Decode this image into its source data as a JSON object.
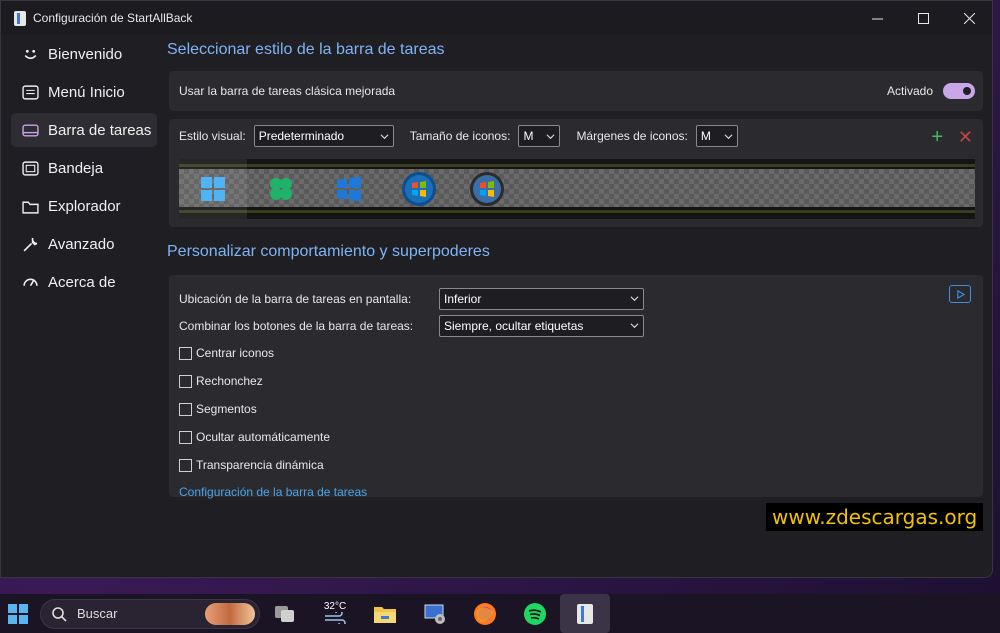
{
  "window": {
    "title": "Configuración de StartAllBack",
    "controls": {
      "minimize": "—",
      "maximize": "☐",
      "close": "✕"
    }
  },
  "sidebar": {
    "items": [
      {
        "label": "Bienvenido",
        "icon": "smile-icon"
      },
      {
        "label": "Menú Inicio",
        "icon": "start-menu-icon"
      },
      {
        "label": "Barra de tareas",
        "icon": "taskbar-icon",
        "active": true
      },
      {
        "label": "Bandeja",
        "icon": "tray-icon"
      },
      {
        "label": "Explorador",
        "icon": "folder-icon"
      },
      {
        "label": "Avanzado",
        "icon": "wrench-icon"
      },
      {
        "label": "Acerca de",
        "icon": "gauge-icon"
      }
    ]
  },
  "taskbar_style": {
    "section_title": "Seleccionar estilo de la barra de tareas",
    "classic_label": "Usar la barra de tareas clásica mejorada",
    "toggle_state": "Activado",
    "visual_style_label": "Estilo visual:",
    "visual_style_value": "Predeterminado",
    "icon_size_label": "Tamaño de iconos:",
    "icon_size_value": "M",
    "icon_margin_label": "Márgenes de iconos:",
    "icon_margin_value": "M",
    "add_symbol": "+",
    "remove_symbol": "✕"
  },
  "behaviour": {
    "section_title": "Personalizar comportamiento y superpoderes",
    "location_label": "Ubicación de la barra de tareas en pantalla:",
    "location_value": "Inferior",
    "combine_label": "Combinar los botones de la barra de tareas:",
    "combine_value": "Siempre, ocultar etiquetas",
    "checkboxes": [
      "Centrar iconos",
      "Rechonchez",
      "Segmentos",
      "Ocultar automáticamente",
      "Transparencia dinámica"
    ],
    "link": "Configuración de la barra de tareas"
  },
  "watermark": "www.zdescargas.org",
  "os_taskbar": {
    "search_placeholder": "Buscar",
    "weather_temp": "32°C"
  },
  "colors": {
    "accent_blue": "#7fb3f5",
    "toggle": "#c9a6e8",
    "link": "#4aa3e8",
    "watermark_text": "#f2c200"
  }
}
